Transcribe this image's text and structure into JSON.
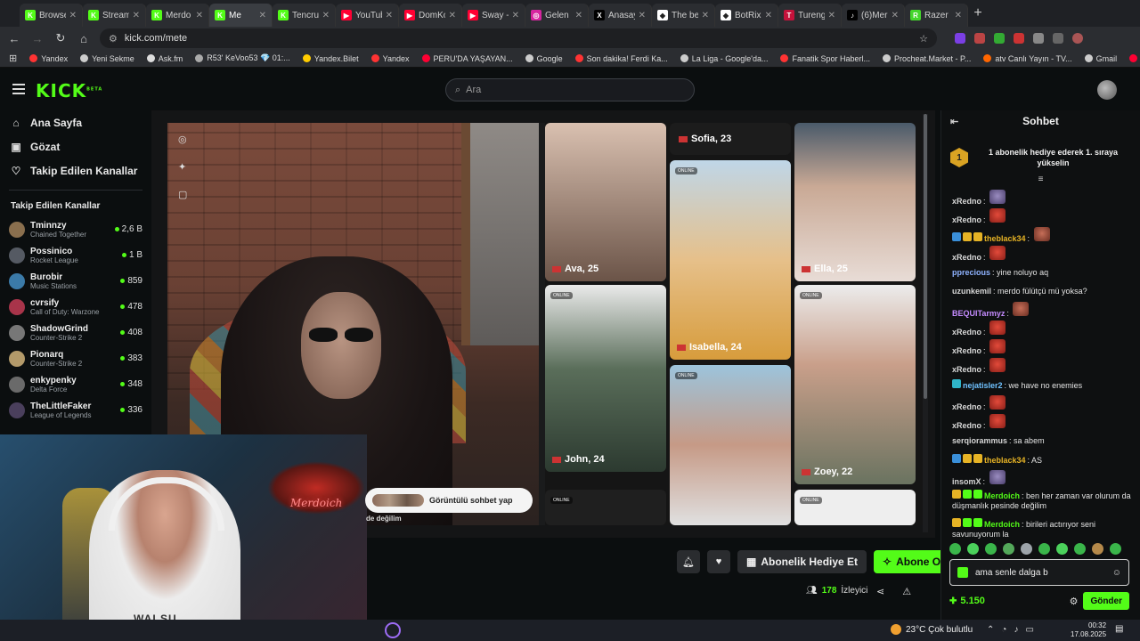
{
  "browser": {
    "tabs": [
      {
        "title": "Browse",
        "color": "#53fc18",
        "glyph": "K"
      },
      {
        "title": "Stream",
        "color": "#53fc18",
        "glyph": "K"
      },
      {
        "title": "Merdo",
        "color": "#53fc18",
        "glyph": "K"
      },
      {
        "title": "Me",
        "color": "#53fc18",
        "glyph": "K"
      },
      {
        "title": "Tencru",
        "color": "#53fc18",
        "glyph": "K"
      },
      {
        "title": "YouTub",
        "color": "#ff0033",
        "glyph": "▶"
      },
      {
        "title": "DomKo",
        "color": "#ff0033",
        "glyph": "▶"
      },
      {
        "title": "Sway -",
        "color": "#ff0033",
        "glyph": "▶"
      },
      {
        "title": "Gelen",
        "color": "#d6249f",
        "glyph": "◎"
      },
      {
        "title": "Anasay",
        "color": "#000000",
        "glyph": "X"
      },
      {
        "title": "The be",
        "color": "#ffffff",
        "glyph": "◆"
      },
      {
        "title": "BotRix",
        "color": "#ffffff",
        "glyph": "◆"
      },
      {
        "title": "Tureng",
        "color": "#c4123b",
        "glyph": "T"
      },
      {
        "title": "(6)Mer",
        "color": "#000000",
        "glyph": "♪"
      },
      {
        "title": "Razer",
        "color": "#44d62c",
        "glyph": "R"
      }
    ],
    "url": "kick.com/mete",
    "bookmarks": [
      {
        "label": "Yandex",
        "color": "#ff3333"
      },
      {
        "label": "Yeni Sekme",
        "color": "#cccccc"
      },
      {
        "label": "Ask.fm",
        "color": "#dddddd"
      },
      {
        "label": "R53' KeVoo53 💎 01:...",
        "color": "#aaaaaa"
      },
      {
        "label": "Yandex.Bilet",
        "color": "#ffcc00"
      },
      {
        "label": "Yandex",
        "color": "#ff3333"
      },
      {
        "label": "PERU'DA YAŞAYAN...",
        "color": "#ff0033"
      },
      {
        "label": "Google",
        "color": "#cccccc"
      },
      {
        "label": "Son dakika! Ferdi Ka...",
        "color": "#ff3333"
      },
      {
        "label": "La Liga - Google'da...",
        "color": "#cccccc"
      },
      {
        "label": "Fanatik Spor Haberl...",
        "color": "#ff3333"
      },
      {
        "label": "Procheat.Market - P...",
        "color": "#cccccc"
      },
      {
        "label": "atv Canlı Yayın - TV...",
        "color": "#ff6600"
      },
      {
        "label": "Gmail",
        "color": "#cccccc"
      },
      {
        "label": "YouTube",
        "color": "#ff0033"
      }
    ]
  },
  "kick": {
    "logo": "KICK",
    "logo_sup": "BETA",
    "search_placeholder": "Ara",
    "nav": [
      {
        "label": "Ana Sayfa",
        "icon": "home-icon",
        "glyph": "⌂"
      },
      {
        "label": "Gözat",
        "icon": "browse-icon",
        "glyph": "▣"
      },
      {
        "label": "Takip Edilen Kanallar",
        "icon": "heart-icon",
        "glyph": "♡"
      }
    ],
    "followed_header": "Takip Edilen Kanallar",
    "channels": [
      {
        "name": "Tminnzy",
        "game": "Chained Together",
        "viewers": "2,6 B",
        "color": "#8a6f4e"
      },
      {
        "name": "Possinico",
        "game": "Rocket League",
        "viewers": "1 B",
        "color": "#555a63"
      },
      {
        "name": "Burobir",
        "game": "Music Stations",
        "viewers": "859",
        "color": "#3b7aa8"
      },
      {
        "name": "cvrsify",
        "game": "Call of Duty: Warzone",
        "viewers": "478",
        "color": "#a8344a"
      },
      {
        "name": "ShadowGrind",
        "game": "Counter-Strike 2",
        "viewers": "408",
        "color": "#777777"
      },
      {
        "name": "Pionarq",
        "game": "Counter-Strike 2",
        "viewers": "383",
        "color": "#b39a6a"
      },
      {
        "name": "enkypenky",
        "game": "Delta Force",
        "viewers": "348",
        "color": "#6a6a6a"
      },
      {
        "name": "TheLittleFaker",
        "game": "League of Legends",
        "viewers": "336",
        "color": "#4a3f5c"
      }
    ]
  },
  "stream": {
    "dating_cards": [
      {
        "label": "Ava, 25"
      },
      {
        "label": "Sofia, 23"
      },
      {
        "label": "Ella, 25"
      },
      {
        "label": "Isabella, 24"
      },
      {
        "label": "John, 24"
      },
      {
        "label": "Zoey, 22"
      }
    ],
    "online_tag": "ONLINE",
    "video_chat_button": "Görüntülü sohbet yap",
    "not_alone_text": "de değilim",
    "webcam_neon": "Merdoich",
    "webcam_shirt": "WAI SU"
  },
  "actions": {
    "gift_label": "Abonelik Hediye Et",
    "subscribe_label": "Abone Ol",
    "viewers": "178",
    "viewers_label": "İzleyici"
  },
  "chat": {
    "title": "Sohbet",
    "promo_rank": "1",
    "promo_text": "1 abonelik hediye ederek 1. sıraya yükselin",
    "messages": [
      {
        "user": "xRedno",
        "color": "#d7d7d7",
        "text": "",
        "emote": "p",
        "badges": []
      },
      {
        "user": "xRedno",
        "color": "#d7d7d7",
        "text": "",
        "emote": "r",
        "badges": []
      },
      {
        "user": "theblack34",
        "color": "#e6b325",
        "text": "",
        "emote": "b",
        "badges": [
          "#3a8fd9",
          "#e6b325",
          "#e6b325"
        ]
      },
      {
        "user": "xRedno",
        "color": "#d7d7d7",
        "text": "",
        "emote": "r",
        "badges": []
      },
      {
        "user": "pprecious",
        "color": "#8fb3ff",
        "text": "yine noluyo aq",
        "emote": "",
        "badges": []
      },
      {
        "user": "uzunkemil",
        "color": "#d7d7d7",
        "text": "merdo fülütçü mü yoksa?",
        "emote": "",
        "badges": []
      },
      {
        "user": "BEQUITarmyz",
        "color": "#c58cff",
        "text": "",
        "emote": "b",
        "badges": []
      },
      {
        "user": "xRedno",
        "color": "#d7d7d7",
        "text": "",
        "emote": "r",
        "badges": []
      },
      {
        "user": "xRedno",
        "color": "#d7d7d7",
        "text": "",
        "emote": "r",
        "badges": []
      },
      {
        "user": "xRedno",
        "color": "#d7d7d7",
        "text": "",
        "emote": "r",
        "badges": []
      },
      {
        "user": "nejatisler2",
        "color": "#6fc2ff",
        "text": "we have no enemies",
        "emote": "",
        "badges": [
          "#2fb5c9"
        ]
      },
      {
        "user": "xRedno",
        "color": "#d7d7d7",
        "text": "",
        "emote": "r",
        "badges": []
      },
      {
        "user": "xRedno",
        "color": "#d7d7d7",
        "text": "",
        "emote": "r",
        "badges": []
      },
      {
        "user": "serqiorammus",
        "color": "#d7d7d7",
        "text": "sa abem",
        "emote": "",
        "badges": []
      },
      {
        "user": "theblack34",
        "color": "#e6b325",
        "text": "AS",
        "emote": "",
        "badges": [
          "#3a8fd9",
          "#e6b325",
          "#e6b325"
        ]
      },
      {
        "user": "insomX",
        "color": "#d7d7d7",
        "text": "",
        "emote": "p",
        "badges": []
      },
      {
        "user": "Merdoich",
        "color": "#53fc18",
        "text": "ben her zaman var olurum da düşmanlık pesinde değilim",
        "emote": "",
        "badges": [
          "#e6b325",
          "#53fc18",
          "#53fc18"
        ],
        "two": true
      },
      {
        "user": "Merdoich",
        "color": "#53fc18",
        "text": "birileri actırıyor seni savunuyorum la",
        "emote": "",
        "badges": [
          "#e6b325",
          "#53fc18",
          "#53fc18"
        ],
        "two": true
      }
    ],
    "input_value": "ama senle dalga b",
    "points": "5.150",
    "send_label": "Gönder"
  },
  "taskbar": {
    "weather": "23°C  Çok bulutlu",
    "time": "00:32",
    "date": "17.08.2025"
  }
}
